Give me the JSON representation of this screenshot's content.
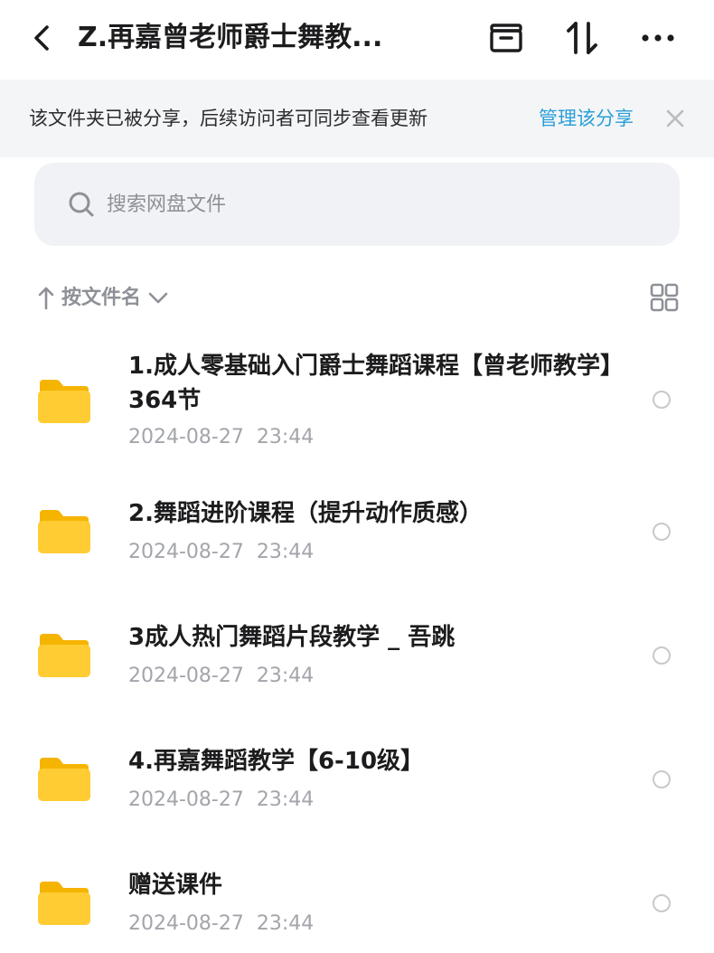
{
  "header": {
    "title": "Z.再嘉曾老师爵士舞教...",
    "back_icon": "chevron-left-icon",
    "actions": [
      "archive-box-icon",
      "sort-updown-icon",
      "more-dots-icon"
    ]
  },
  "banner": {
    "text": "该文件夹已被分享，后续访问者可同步查看更新",
    "link": "管理该分享",
    "link_color": "#2a9fd8",
    "close_icon": "close-icon"
  },
  "search": {
    "placeholder": "搜索网盘文件",
    "icon": "search-icon"
  },
  "sort": {
    "label": "按文件名",
    "direction_icon": "arrow-up-icon",
    "dropdown_icon": "chevron-down-icon",
    "view_toggle_icon": "grid-view-icon"
  },
  "files": [
    {
      "name": "1.成人零基础入门爵士舞蹈课程【曾老师教学】364节",
      "date": "2024-08-27  23:44",
      "type": "folder"
    },
    {
      "name": "2.舞蹈进阶课程（提升动作质感）",
      "date": "2024-08-27  23:44",
      "type": "folder"
    },
    {
      "name": "3成人热门舞蹈片段教学 _ 吾跳",
      "date": "2024-08-27  23:44",
      "type": "folder"
    },
    {
      "name": "4.再嘉舞蹈教学【6-10级】",
      "date": "2024-08-27  23:44",
      "type": "folder"
    },
    {
      "name": "赠送课件",
      "date": "2024-08-27  23:44",
      "type": "folder"
    }
  ],
  "colors": {
    "folder": "#ffcc33",
    "folder_back": "#f5b400",
    "secondary_text": "#a3a5ab",
    "banner_bg": "#f4f5f7",
    "search_bg": "#f1f2f6"
  }
}
